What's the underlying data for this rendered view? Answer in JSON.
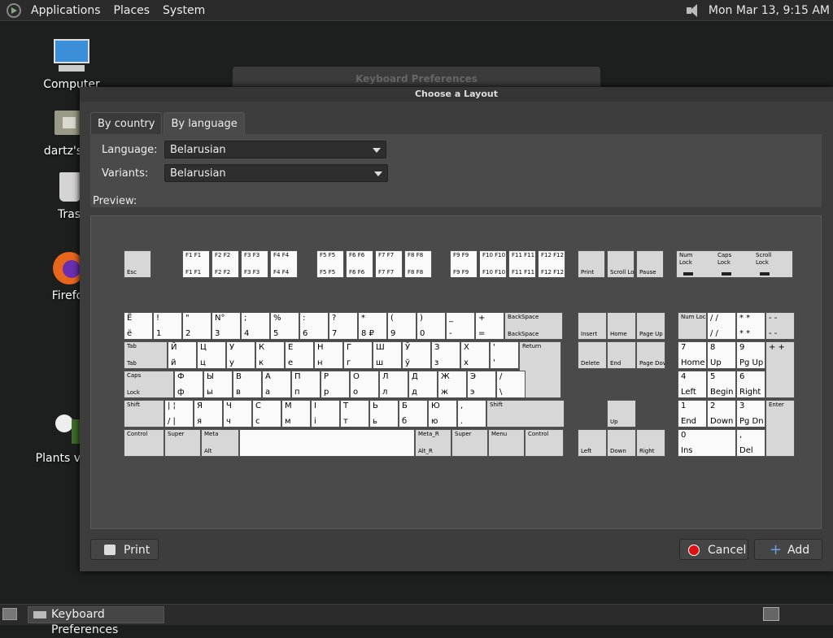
{
  "top_panel": {
    "menus": [
      "Applications",
      "Places",
      "System"
    ],
    "clock": "Mon Mar 13,  9:15 AM"
  },
  "desktop": {
    "icons": [
      "Computer",
      "dartz's H",
      "Tras",
      "Firefo",
      "Plants vs Z"
    ]
  },
  "background_window": {
    "title": "Keyboard Preferences"
  },
  "dialog": {
    "title": "Choose a Layout",
    "tabs": [
      "By country",
      "By language"
    ],
    "language_label": "Language:",
    "language_value": "Belarusian",
    "variants_label": "Variants:",
    "variants_value": "Belarusian",
    "preview_label": "Preview:",
    "print_label": "Print",
    "cancel_label": "Cancel",
    "add_label": "Add"
  },
  "keyboard": {
    "fn_row": [
      {
        "t": "Esc"
      },
      {
        "t": "F1 F1",
        "b": "F1 F1"
      },
      {
        "t": "F2 F2",
        "b": "F2 F2"
      },
      {
        "t": "F3 F3",
        "b": "F3 F3"
      },
      {
        "t": "F4 F4",
        "b": "F4 F4"
      },
      {
        "t": "F5 F5",
        "b": "F5 F5"
      },
      {
        "t": "F6 F6",
        "b": "F6 F6"
      },
      {
        "t": "F7 F7",
        "b": "F7 F7"
      },
      {
        "t": "F8 F8",
        "b": "F8 F8"
      },
      {
        "t": "F9 F9",
        "b": "F9 F9"
      },
      {
        "t": "F10 F10",
        "b": "F10 F10"
      },
      {
        "t": "F11 F11",
        "b": "F11 F11"
      },
      {
        "t": "F12 F12",
        "b": "F12 F12"
      },
      {
        "t": "Print"
      },
      {
        "t": "Scroll Lock"
      },
      {
        "t": "Pause"
      }
    ],
    "leds": [
      "Num Lock",
      "Caps Lock",
      "Scroll Lock"
    ],
    "row1": [
      [
        "Ё",
        "ё"
      ],
      [
        "!",
        "1"
      ],
      [
        "\"",
        "2"
      ],
      [
        "N°",
        "3"
      ],
      [
        ";",
        "4"
      ],
      [
        "%",
        "5"
      ],
      [
        ":",
        "6"
      ],
      [
        "?",
        "7"
      ],
      [
        "*",
        "8 ₽"
      ],
      [
        "(",
        "9"
      ],
      [
        ")",
        "0"
      ],
      [
        "_",
        "-"
      ],
      [
        "+",
        "="
      ],
      [
        "BackSpace",
        "BackSpace"
      ]
    ],
    "row2": [
      [
        "Tab",
        "Tab"
      ],
      [
        "Й",
        "й"
      ],
      [
        "Ц",
        "ц"
      ],
      [
        "У",
        "у"
      ],
      [
        "К",
        "к"
      ],
      [
        "Е",
        "е"
      ],
      [
        "Н",
        "н"
      ],
      [
        "Г",
        "г"
      ],
      [
        "Ш",
        "ш"
      ],
      [
        "Ў",
        "ў"
      ],
      [
        "З",
        "з"
      ],
      [
        "Х",
        "х"
      ],
      [
        "'",
        "'"
      ],
      [
        "Return",
        ""
      ]
    ],
    "row3": [
      [
        "Caps",
        "Lock"
      ],
      [
        "Ф",
        "ф"
      ],
      [
        "Ы",
        "ы"
      ],
      [
        "В",
        "в"
      ],
      [
        "А",
        "а"
      ],
      [
        "П",
        "п"
      ],
      [
        "Р",
        "р"
      ],
      [
        "О",
        "о"
      ],
      [
        "Л",
        "л"
      ],
      [
        "Д",
        "д"
      ],
      [
        "Ж",
        "ж"
      ],
      [
        "Э",
        "э"
      ],
      [
        "/",
        "\\"
      ]
    ],
    "row4": [
      [
        "Shift",
        ""
      ],
      [
        "| ¦",
        "/ |"
      ],
      [
        "Я",
        "я"
      ],
      [
        "Ч",
        "ч"
      ],
      [
        "С",
        "с"
      ],
      [
        "М",
        "м"
      ],
      [
        "І",
        "і"
      ],
      [
        "Т",
        "т"
      ],
      [
        "Ь",
        "ь"
      ],
      [
        "Б",
        "б"
      ],
      [
        "Ю",
        "ю"
      ],
      [
        ",",
        "."
      ],
      [
        "Shift",
        ""
      ]
    ],
    "row5": [
      [
        "Control"
      ],
      [
        "Super"
      ],
      [
        "Meta",
        "Alt"
      ],
      [
        ""
      ],
      [
        "Meta_R",
        "Alt_R"
      ],
      [
        "Super"
      ],
      [
        "Menu"
      ],
      [
        "Control"
      ]
    ],
    "nav": [
      [
        "Insert"
      ],
      [
        "Home"
      ],
      [
        "Page Up"
      ],
      [
        "Delete"
      ],
      [
        "End"
      ],
      [
        "Page Down"
      ],
      [
        "Up"
      ],
      [
        "Left"
      ],
      [
        "Down"
      ],
      [
        "Right"
      ]
    ],
    "numpad": [
      [
        "Num Lock",
        ""
      ],
      [
        "/  /",
        "/  /"
      ],
      [
        "*  *",
        "*  *"
      ],
      [
        "-  -",
        "-  -"
      ],
      [
        "7",
        "Home"
      ],
      [
        "8",
        "Up"
      ],
      [
        "9",
        "Pg Up"
      ],
      [
        "+  +",
        ""
      ],
      [
        "4",
        "Left"
      ],
      [
        "5",
        "Begin"
      ],
      [
        "6",
        "Right"
      ],
      [
        "1",
        "End"
      ],
      [
        "2",
        "Down"
      ],
      [
        "3",
        "Pg Dn"
      ],
      [
        "Enter",
        ""
      ],
      [
        "0",
        "Ins"
      ],
      [
        ",",
        "Del"
      ]
    ]
  },
  "taskbar": {
    "window_button": "Keyboard Preferences"
  }
}
